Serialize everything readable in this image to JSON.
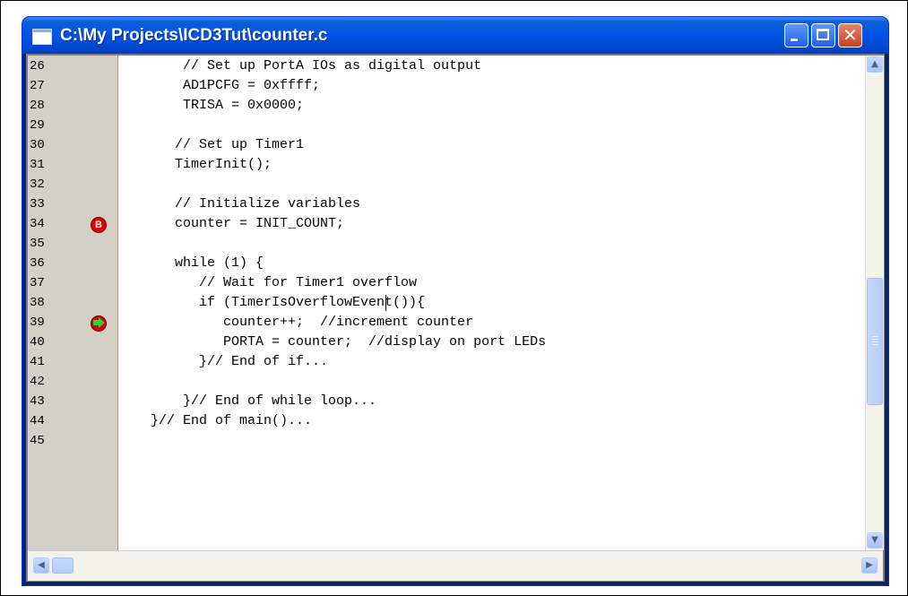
{
  "window": {
    "title": "C:\\My Projects\\ICD3Tut\\counter.c"
  },
  "controls": {
    "minimize_icon": "minimize-icon",
    "maximize_icon": "maximize-icon",
    "close_glyph": "✕"
  },
  "editor": {
    "breakpoint_label": "B",
    "lines": [
      {
        "n": "26",
        "text": "        // Set up PortA IOs as digital output"
      },
      {
        "n": "27",
        "text": "        AD1PCFG = 0xffff;"
      },
      {
        "n": "28",
        "text": "        TRISA = 0x0000;"
      },
      {
        "n": "29",
        "text": ""
      },
      {
        "n": "30",
        "text": "       // Set up Timer1"
      },
      {
        "n": "31",
        "text": "       TimerInit();"
      },
      {
        "n": "32",
        "text": ""
      },
      {
        "n": "33",
        "text": "       // Initialize variables"
      },
      {
        "n": "34",
        "text": "       counter = INIT_COUNT;"
      },
      {
        "n": "35",
        "text": ""
      },
      {
        "n": "36",
        "text": "       while (1) {"
      },
      {
        "n": "37",
        "text": "          // Wait for Timer1 overflow"
      },
      {
        "n": "38",
        "text": "          if (TimerIsOverflowEvent()){"
      },
      {
        "n": "39",
        "text": "             counter++;  //increment counter"
      },
      {
        "n": "40",
        "text": "             PORTA = counter;  //display on port LEDs"
      },
      {
        "n": "41",
        "text": "          }// End of if..."
      },
      {
        "n": "42",
        "text": ""
      },
      {
        "n": "43",
        "text": "        }// End of while loop..."
      },
      {
        "n": "44",
        "text": "    }// End of main()..."
      },
      {
        "n": "45",
        "text": ""
      }
    ]
  },
  "scrollbars": {
    "up_arrow": "▲",
    "down_arrow": "▼",
    "left_arrow": "◀",
    "right_arrow": "▶"
  }
}
